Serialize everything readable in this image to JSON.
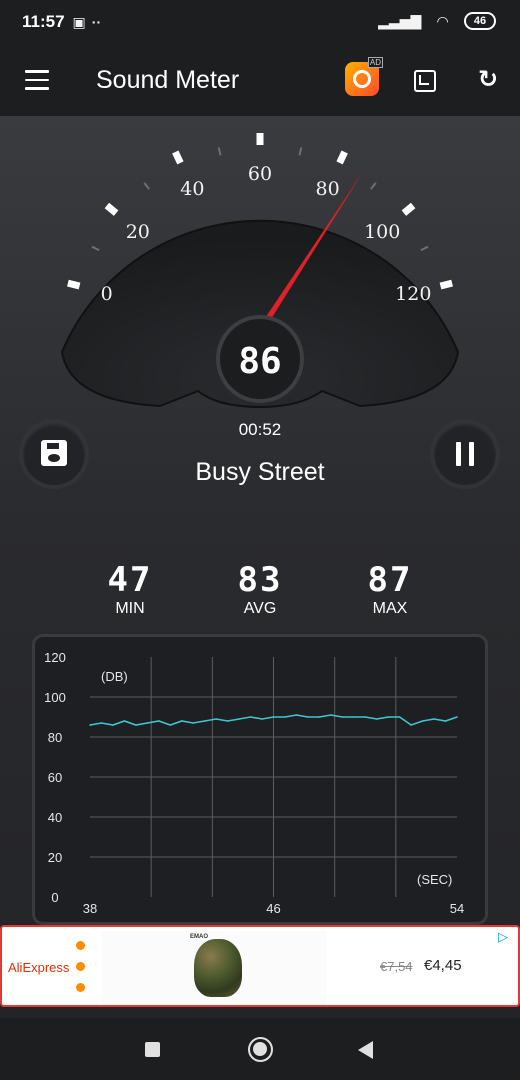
{
  "status_bar": {
    "time": "11:57",
    "battery": "46"
  },
  "app_bar": {
    "title": "Sound Meter",
    "ad_badge": "AD"
  },
  "gauge": {
    "value": 86,
    "display": "86",
    "min": 0,
    "max": 120,
    "tick_labels": [
      "0",
      "20",
      "40",
      "60",
      "80",
      "100",
      "120"
    ]
  },
  "recording": {
    "timer": "00:52",
    "location": "Busy Street"
  },
  "stats": {
    "min": {
      "value": "47",
      "label": "MIN"
    },
    "avg": {
      "value": "83",
      "label": "AVG"
    },
    "max": {
      "value": "87",
      "label": "MAX"
    }
  },
  "chart_data": {
    "type": "line",
    "ylabel": "(DB)",
    "xlabel": "(SEC)",
    "y_ticks": [
      "0",
      "20",
      "40",
      "60",
      "80",
      "100",
      "120"
    ],
    "x_ticks": [
      "38",
      "46",
      "54"
    ],
    "xlim": [
      38,
      54
    ],
    "ylim": [
      0,
      120
    ],
    "grid": true,
    "color": "#3ec6cf",
    "series": [
      {
        "x": [
          38,
          38.5,
          39,
          39.5,
          40,
          40.5,
          41,
          41.5,
          42,
          42.5,
          43,
          43.5,
          44,
          44.5,
          45,
          45.5,
          46,
          46.5,
          47,
          47.5,
          48,
          48.5,
          49,
          49.5,
          50,
          50.5,
          51,
          51.5,
          52,
          52.5,
          53,
          53.5,
          54
        ],
        "values": [
          86,
          87,
          86,
          88,
          86,
          87,
          88,
          86,
          88,
          87,
          88,
          89,
          88,
          89,
          90,
          89,
          90,
          90,
          91,
          90,
          90,
          91,
          90,
          90,
          90,
          89,
          90,
          90,
          86,
          88,
          89,
          88,
          90
        ]
      }
    ]
  },
  "ad": {
    "brand": "AliExpress",
    "product_brand": "EMAO",
    "old_price": "€7,54",
    "new_price": "€4,45"
  }
}
